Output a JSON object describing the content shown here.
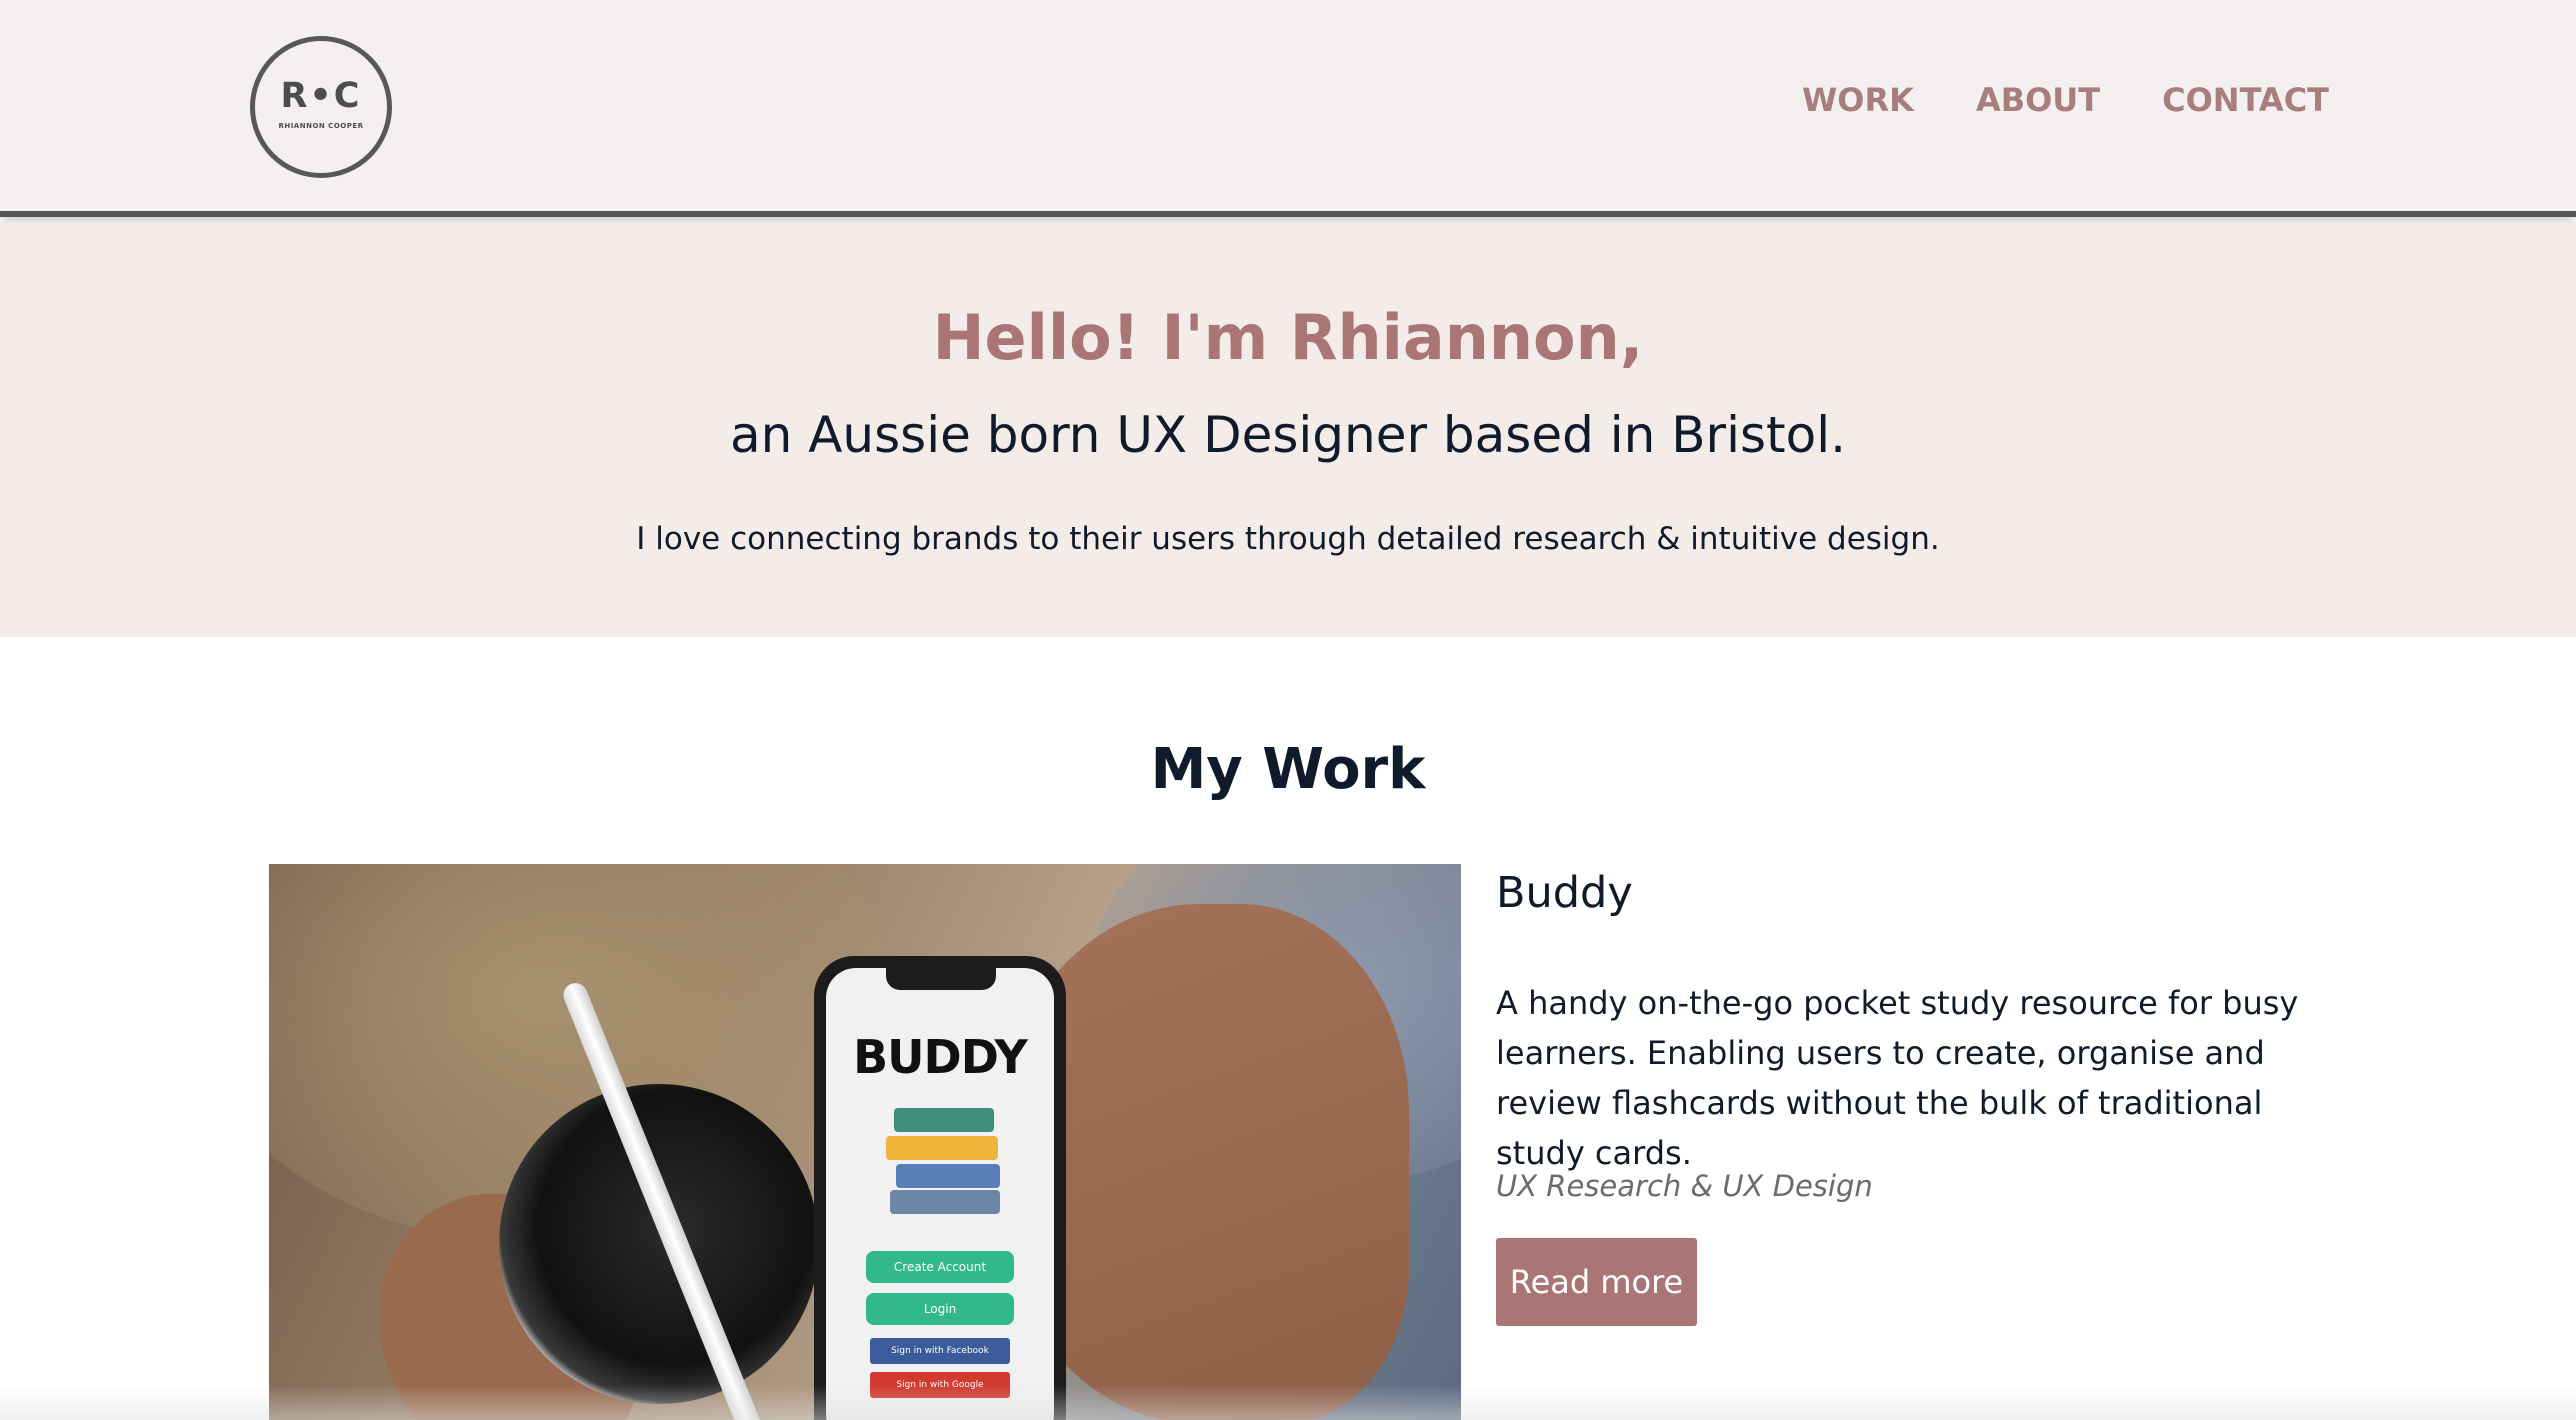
{
  "header": {
    "logo": {
      "initials": "R•C",
      "name": "RHIANNON COOPER"
    },
    "nav": [
      {
        "label": "WORK"
      },
      {
        "label": "ABOUT"
      },
      {
        "label": "CONTACT"
      }
    ]
  },
  "hero": {
    "title": "Hello! I'm Rhiannon,",
    "subtitle": "an Aussie born UX Designer based in Bristol.",
    "intro": "I love connecting brands to their users through detailed research & intuitive design."
  },
  "work": {
    "section_title": "My Work",
    "projects": [
      {
        "name": "Buddy",
        "description": "A handy on-the-go pocket study resource for busy learners. Enabling users to create, organise and review flashcards without the bulk of traditional study cards.",
        "tags": "UX Research & UX Design",
        "button_label": "Read more",
        "image": {
          "phone_title": "BUDDY",
          "buttons": [
            "Create Account",
            "Login",
            "Sign in with Facebook",
            "Sign in with Google"
          ]
        }
      }
    ]
  },
  "colors": {
    "accent": "#a97675",
    "nav": "#a87e7d",
    "header_bg": "#f4f0ef",
    "hero_bg": "#f4ece9",
    "text": "#0f1b2b"
  }
}
